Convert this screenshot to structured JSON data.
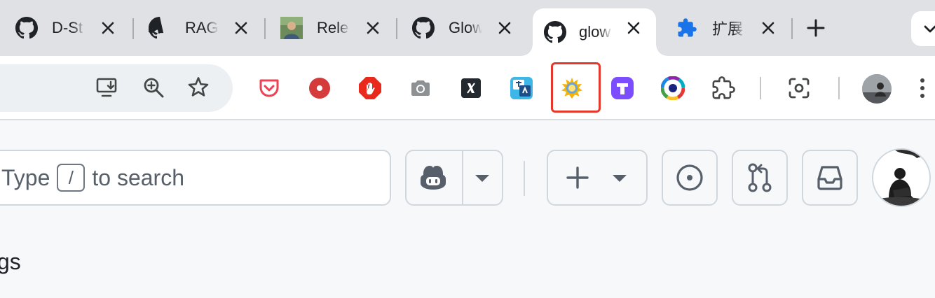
{
  "tabs": [
    {
      "title": "D-St",
      "favicon": "github-icon",
      "active": false
    },
    {
      "title": "RAG",
      "favicon": "github-icon",
      "active": false
    },
    {
      "title": "Rele",
      "favicon": "profile-photo-icon",
      "active": false
    },
    {
      "title": "Glow",
      "favicon": "github-icon",
      "active": false
    },
    {
      "title": "glow",
      "favicon": "github-icon",
      "active": true
    },
    {
      "title": "扩展",
      "favicon": "puzzle-icon",
      "active": false
    }
  ],
  "search": {
    "prefix": "Type",
    "shortcut": "/",
    "suffix": "to search"
  },
  "page": {
    "heading_fragment": "gs"
  },
  "colors": {
    "highlight": "#e5382b",
    "tab_strip": "#dfe1e5",
    "extension_blue": "#1a73e8"
  },
  "extensions": [
    "pocket-icon",
    "record-icon",
    "adblock-icon",
    "camera-icon",
    "x-icon",
    "translator-icon",
    "sun-glow-icon",
    "tab-manager-icon",
    "color-wheel-icon",
    "puzzle-extensions-icon",
    "screenshot-lens-icon",
    "profile-avatar",
    "menu-icon"
  ]
}
